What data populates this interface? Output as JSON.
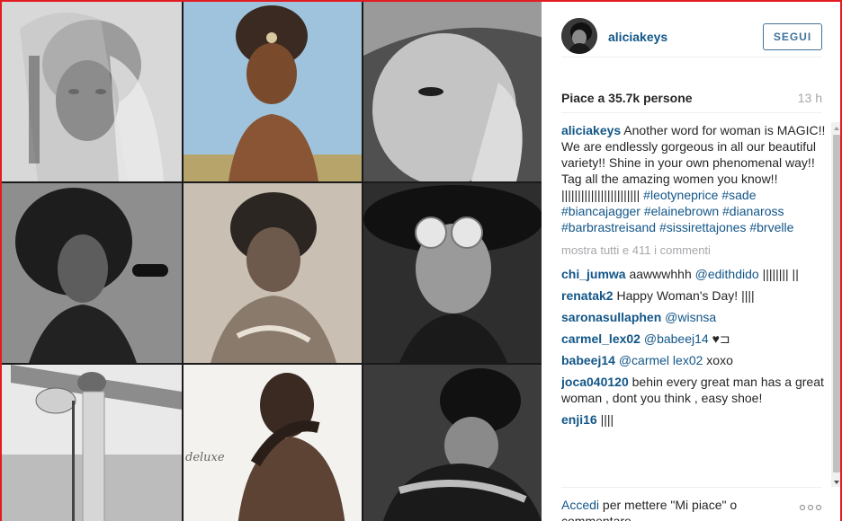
{
  "post": {
    "username": "aliciakeys",
    "follow_label": "SEGUI",
    "likes": "Piace a 35.7k persone",
    "time_ago": "13 h"
  },
  "caption": {
    "username": "aliciakeys",
    "text": "Another word for woman is MAGIC!! We are endlessly gorgeous in all our beautiful variety!! Shine in your own phenomenal way!! Tag all the amazing women you know!! ||||||||||||||||||||||||",
    "hashtags": "#leotyneprice #sade #biancajagger #elainebrown #dianaross #barbrastreisand #sissirettajones #brvelle"
  },
  "more_comments": "mostra tutti e 411 i commenti",
  "comments": [
    {
      "user": "chi_jumwa",
      "text": "aawwwhhh",
      "mention": "@edithdido",
      "suffix": " |||||||| ||"
    },
    {
      "user": "renatak2",
      "text": "Happy Woman's Day! ||||",
      "mention": "",
      "suffix": ""
    },
    {
      "user": "saronasullaphen",
      "text": "",
      "mention": "@wisnsa",
      "suffix": ""
    },
    {
      "user": "carmel_lex02",
      "text": "",
      "mention": "@babeej14",
      "suffix": " ♥⊐"
    },
    {
      "user": "babeej14",
      "text": "",
      "mention": "@carmel lex02",
      "suffix": " xoxo"
    },
    {
      "user": "joca040120",
      "text": "behin every great man has a great woman , dont you think , easy shoe!",
      "mention": "",
      "suffix": ""
    },
    {
      "user": "enji16",
      "text": "||||",
      "mention": "",
      "suffix": ""
    }
  ],
  "footer": {
    "login_link": "Accedi",
    "login_rest": " per mettere \"Mi piace\" o commentare."
  },
  "collage": {
    "tile_label_deluxe": "deluxe"
  },
  "icons": {
    "avatar": "avatar-icon",
    "more": "more-options-icon"
  }
}
